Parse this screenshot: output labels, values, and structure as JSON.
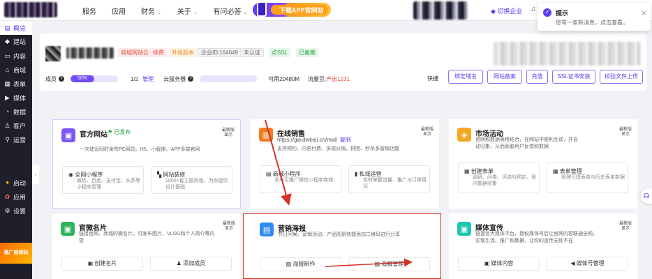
{
  "topbar": {
    "nav": [
      "服务",
      "应用",
      "财务",
      "关于",
      "有问必答"
    ],
    "nav_carets": [
      false,
      false,
      true,
      true,
      true
    ],
    "promo": "下载APP官网站",
    "switch_enterprise": "◆ 切换企业",
    "icon": "bell-icon"
  },
  "notification": {
    "title": "提示",
    "message": "您有一条新消息，点击查看。"
  },
  "sidebar": {
    "items": [
      {
        "label": "概览",
        "icon": "overview-icon"
      },
      {
        "label": "建站",
        "icon": "build-icon"
      },
      {
        "label": "内容",
        "icon": "content-icon"
      },
      {
        "label": "商城",
        "icon": "shop-icon"
      },
      {
        "label": "表单",
        "icon": "form-icon"
      },
      {
        "label": "媒体",
        "icon": "media-icon"
      },
      {
        "label": "数据",
        "icon": "data-icon"
      },
      {
        "label": "客户",
        "icon": "customer-icon"
      },
      {
        "label": "运营",
        "icon": "operate-icon"
      }
    ],
    "bottom": [
      {
        "label": "启动",
        "icon": "launch-icon"
      },
      {
        "label": "应用",
        "icon": "apps-icon"
      },
      {
        "label": "设置",
        "icon": "settings-icon"
      }
    ],
    "banner": "福广推荐码"
  },
  "info": {
    "tags": [
      "商城网站云",
      "续费",
      "升级版本",
      "企业ID:164049",
      "未认证",
      "点SSL",
      "已备案"
    ],
    "members_label": "成员",
    "members_percent": 50,
    "members_percent_text": "50%",
    "members_count": "1/2",
    "manage": "管理",
    "cloud_label": "云服务器",
    "available": "可用20480M",
    "traffic_label": "流量豆:",
    "traffic_value": "产出1231",
    "quick_label": "快捷",
    "quick_buttons": [
      "绑定域名",
      "网站备案",
      "充值",
      "SSL证书安装",
      "校验文件上传"
    ]
  },
  "cards": {
    "official_site": {
      "title": "官方网站",
      "status": "已发布",
      "corner": "最新版\n显示",
      "desc": "一次建设同时发布PC网站、H5、小程序、APP多端官网",
      "subs": [
        {
          "title": "全网小程序",
          "desc": "微信、百度、支付宝、头条等小程序管理"
        },
        {
          "title": "网站装修",
          "desc": "2000+套主题风格，为你提供设计基础"
        }
      ]
    },
    "online_sales": {
      "title": "在线销售",
      "corner": "最新版\n显示",
      "url": "https://gw.dwkeji.cn/mall",
      "copy": "复制",
      "desc": "支持预约、内容付费、多规分销、拼团、秒杀多营销功能",
      "subs": [
        {
          "title": "商城小程序",
          "desc": "发布可推广微信小程序商城"
        },
        {
          "title": "私域运营",
          "desc": "实时掌握流量、推广与订单情况"
        }
      ]
    },
    "marketing": {
      "title": "市场活动",
      "corner": "最新版\n显示",
      "desc": "官网和数据表格结合，在网站中便利互动，并自动归集，从而获取用户反馈和数据",
      "subs": [
        {
          "title": "创建表单",
          "desc": "调研、问卷、评选与预定、登内数据收集"
        },
        {
          "title": "表单管理",
          "desc": "管理已建表单与历史表单数据"
        }
      ]
    },
    "wechat_card": {
      "title": "官微名片",
      "corner": "最新版\n显示",
      "desc": "链接官网、商城的微名片，可发布图片、VLOG和个人简介等内容",
      "buttons": [
        "创建名片",
        "添加成员"
      ]
    },
    "poster": {
      "title": "营销海报",
      "desc": "节日问候、营销活动、产品图册快捷添加二维码进行分享",
      "buttons": [
        "海报制作",
        "海报管理"
      ]
    },
    "media": {
      "title": "媒体宣传",
      "corner": "最新版\n显示",
      "desc": "链接各大媒体平台，授权媒体号后让官网内容联通全网，实现引流、推广和数据，让你的宣传无处不在",
      "buttons": [
        "媒体内容",
        "媒体号管理"
      ]
    }
  }
}
